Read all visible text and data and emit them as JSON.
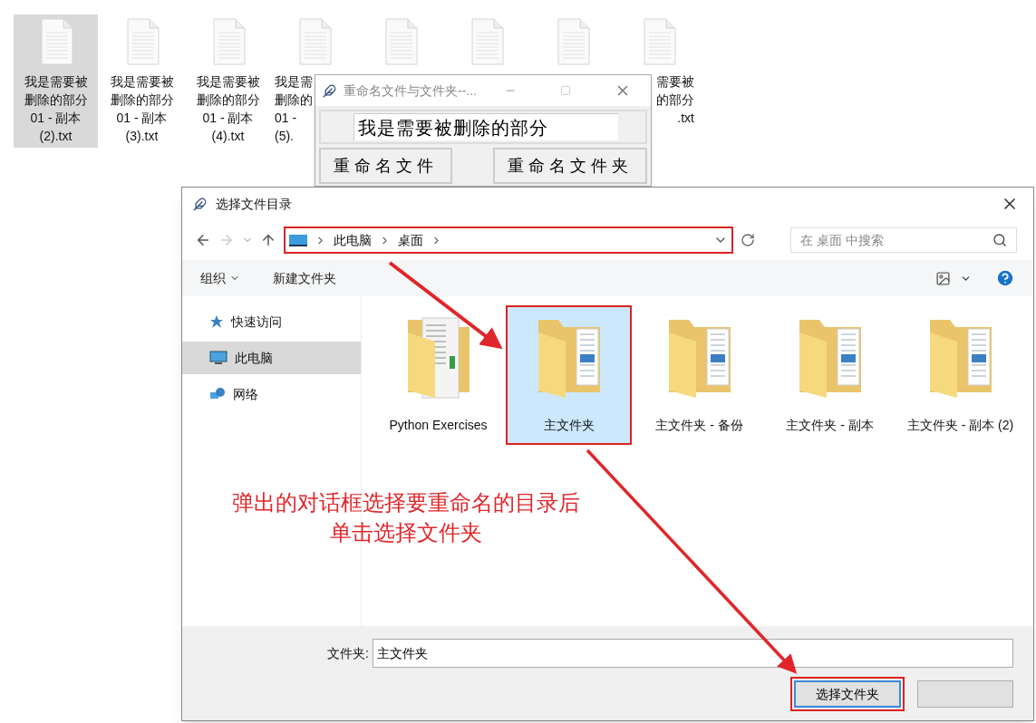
{
  "desktop": {
    "icons": [
      {
        "kind": "full",
        "lines": [
          "我是需要被",
          "删除的部分",
          "01 - 副本",
          "(2).txt"
        ],
        "selected": true
      },
      {
        "kind": "full",
        "lines": [
          "我是需要被",
          "删除的部分",
          "01 - 副本",
          "(3).txt"
        ],
        "selected": false
      },
      {
        "kind": "full",
        "lines": [
          "我是需要被",
          "删除的部分",
          "01 - 副本",
          "(4).txt"
        ],
        "selected": false
      },
      {
        "kind": "cut_right",
        "lines": [
          "我是需",
          "删除的",
          "01 -",
          "(5)."
        ],
        "selected": false
      },
      {
        "kind": "icon_only",
        "selected": false
      },
      {
        "kind": "icon_only",
        "selected": false
      },
      {
        "kind": "icon_only",
        "selected": false
      },
      {
        "kind": "cut_left",
        "lines": [
          "需要被",
          "的部分",
          ".txt"
        ],
        "selected": false
      }
    ]
  },
  "rename_window": {
    "title": "重命名文件与文件夹--...",
    "entry_value": "我是需要被删除的部分",
    "buttons": [
      "重命名文件",
      "重命名文件夹"
    ]
  },
  "dialog": {
    "title": "选择文件目录",
    "breadcrumb": [
      "此电脑",
      "桌面"
    ],
    "search": {
      "placeholder": "在 桌面 中搜索"
    },
    "toolbar": {
      "organize": "组织",
      "new_folder": "新建文件夹"
    },
    "sidebar": {
      "items": [
        {
          "kind": "star",
          "label": "快速访问",
          "selected": false
        },
        {
          "kind": "pc",
          "label": "此电脑",
          "selected": true
        },
        {
          "kind": "network",
          "label": "网络",
          "selected": false
        }
      ]
    },
    "folders": [
      {
        "kind": "document",
        "name": "Python Exercises",
        "selected": false
      },
      {
        "kind": "plain",
        "name": "主文件夹",
        "selected": true
      },
      {
        "kind": "plain",
        "name": "主文件夹 - 备份",
        "selected": false
      },
      {
        "kind": "plain",
        "name": "主文件夹 - 副本",
        "selected": false
      },
      {
        "kind": "plain",
        "name": "主文件夹 - 副本 (2)",
        "selected": false
      }
    ],
    "folder_label": "文件夹:",
    "folder_value": "主文件夹",
    "buttons": [
      "选择文件夹"
    ]
  },
  "annotation": {
    "lines": [
      "弹出的对话框选择要重命名的目录后",
      "单击选择文件夹"
    ]
  }
}
